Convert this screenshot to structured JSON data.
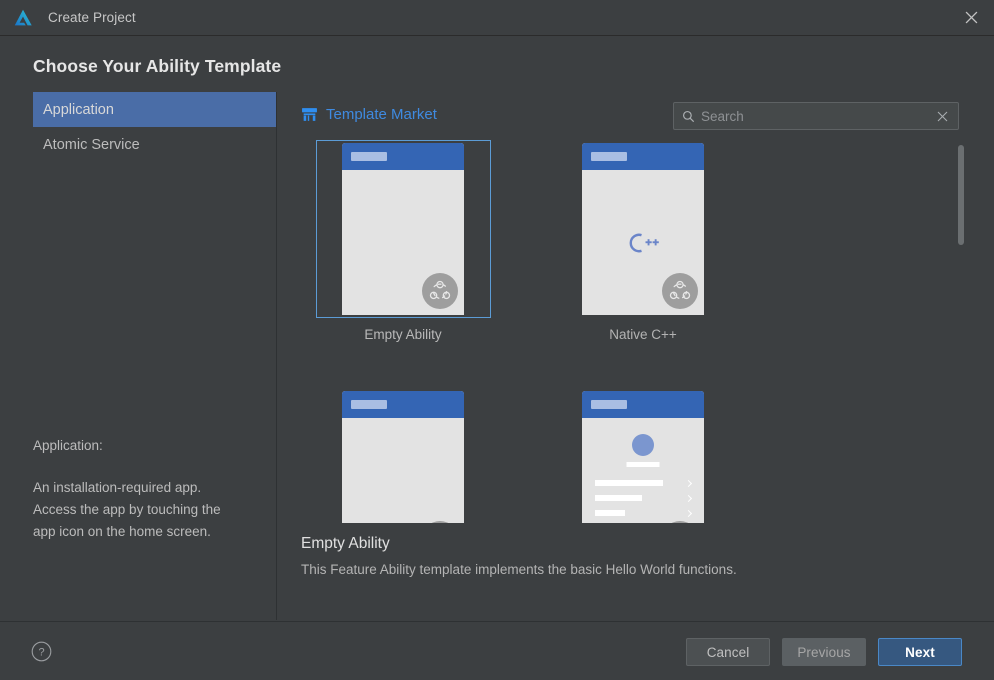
{
  "window": {
    "title": "Create Project",
    "logo_icon": "deveco-logo-icon",
    "close_icon": "close-icon"
  },
  "page": {
    "title": "Choose Your Ability Template"
  },
  "sidebar": {
    "items": [
      {
        "label": "Application",
        "selected": true
      },
      {
        "label": "Atomic Service",
        "selected": false
      }
    ],
    "description_title": "Application:",
    "description_body": "An installation-required app.\nAccess the app by touching the\napp icon on the home screen."
  },
  "content": {
    "market_link": {
      "label": "Template Market",
      "icon": "store-icon",
      "color": "#3f8ae0"
    },
    "search": {
      "placeholder": "Search",
      "value": "",
      "search_icon": "search-icon",
      "clear_icon": "clear-x-icon"
    },
    "templates": [
      {
        "label": "Empty Ability",
        "selected": true,
        "art": "blank",
        "badge": "ability-badge-icon"
      },
      {
        "label": "Native C++",
        "selected": false,
        "art": "cpp",
        "badge": "ability-badge-icon"
      },
      {
        "label": "",
        "selected": false,
        "art": "blank",
        "badge": "ability-badge-icon"
      },
      {
        "label": "",
        "selected": false,
        "art": "settings",
        "badge": "ability-badge-icon"
      }
    ],
    "selected_template": {
      "name": "Empty Ability",
      "description": "This Feature Ability template implements the basic Hello World functions."
    }
  },
  "footer": {
    "help_icon": "help-question-icon",
    "cancel_label": "Cancel",
    "previous_label": "Previous",
    "next_label": "Next"
  },
  "colors": {
    "background": "#3c3f41",
    "selection_blue": "#4a6da7",
    "link_blue": "#3f8ae0",
    "primary_button": "#365880",
    "card_border_blue": "#5c9cd6",
    "phone_header": "#3465b4"
  }
}
